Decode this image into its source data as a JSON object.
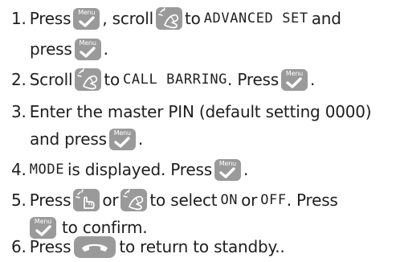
{
  "instructions": {
    "step1": {
      "number": "1.",
      "press_label": "Press",
      "comma_scroll": ", scroll",
      "to_label": "to",
      "lcd_item": "ADVANCED SET",
      "and_label": "and",
      "press_label_2": "press",
      "period": "."
    },
    "step2": {
      "number": "2.",
      "scroll_label": "Scroll",
      "to_label": "to",
      "lcd_item": "CALL BARRING",
      "press_label": ". Press",
      "period": "."
    },
    "step3": {
      "number": "3.",
      "text_line1": "Enter the master PIN (default setting 0000)",
      "and_press_label": "and press",
      "period": "."
    },
    "step4": {
      "number": "4.",
      "lcd_item": "MODE",
      "displayed_label": "is displayed. Press",
      "period": "."
    },
    "step5": {
      "number": "5.",
      "press_label": "Press",
      "or_label": "or",
      "to_select_label": "to select",
      "lcd_on": "ON",
      "or_label_2": "or",
      "lcd_off": "OFF",
      "press_label_2": ". Press",
      "to_confirm_label": "to confirm."
    },
    "step6": {
      "number": "6.",
      "press_label": "Press",
      "return_label": "to return to standby.."
    }
  },
  "key_icons": {
    "menu_key_text": "Menu",
    "menu_key_icon": "menu-check-key-icon",
    "scroll_key_icon": "scroll-hand-key-icon",
    "end_key_icon": "end-call-key-icon"
  },
  "colors": {
    "key_background": "#9a9a9a",
    "key_symbol": "#ffffff",
    "text": "#1e1e1e"
  }
}
